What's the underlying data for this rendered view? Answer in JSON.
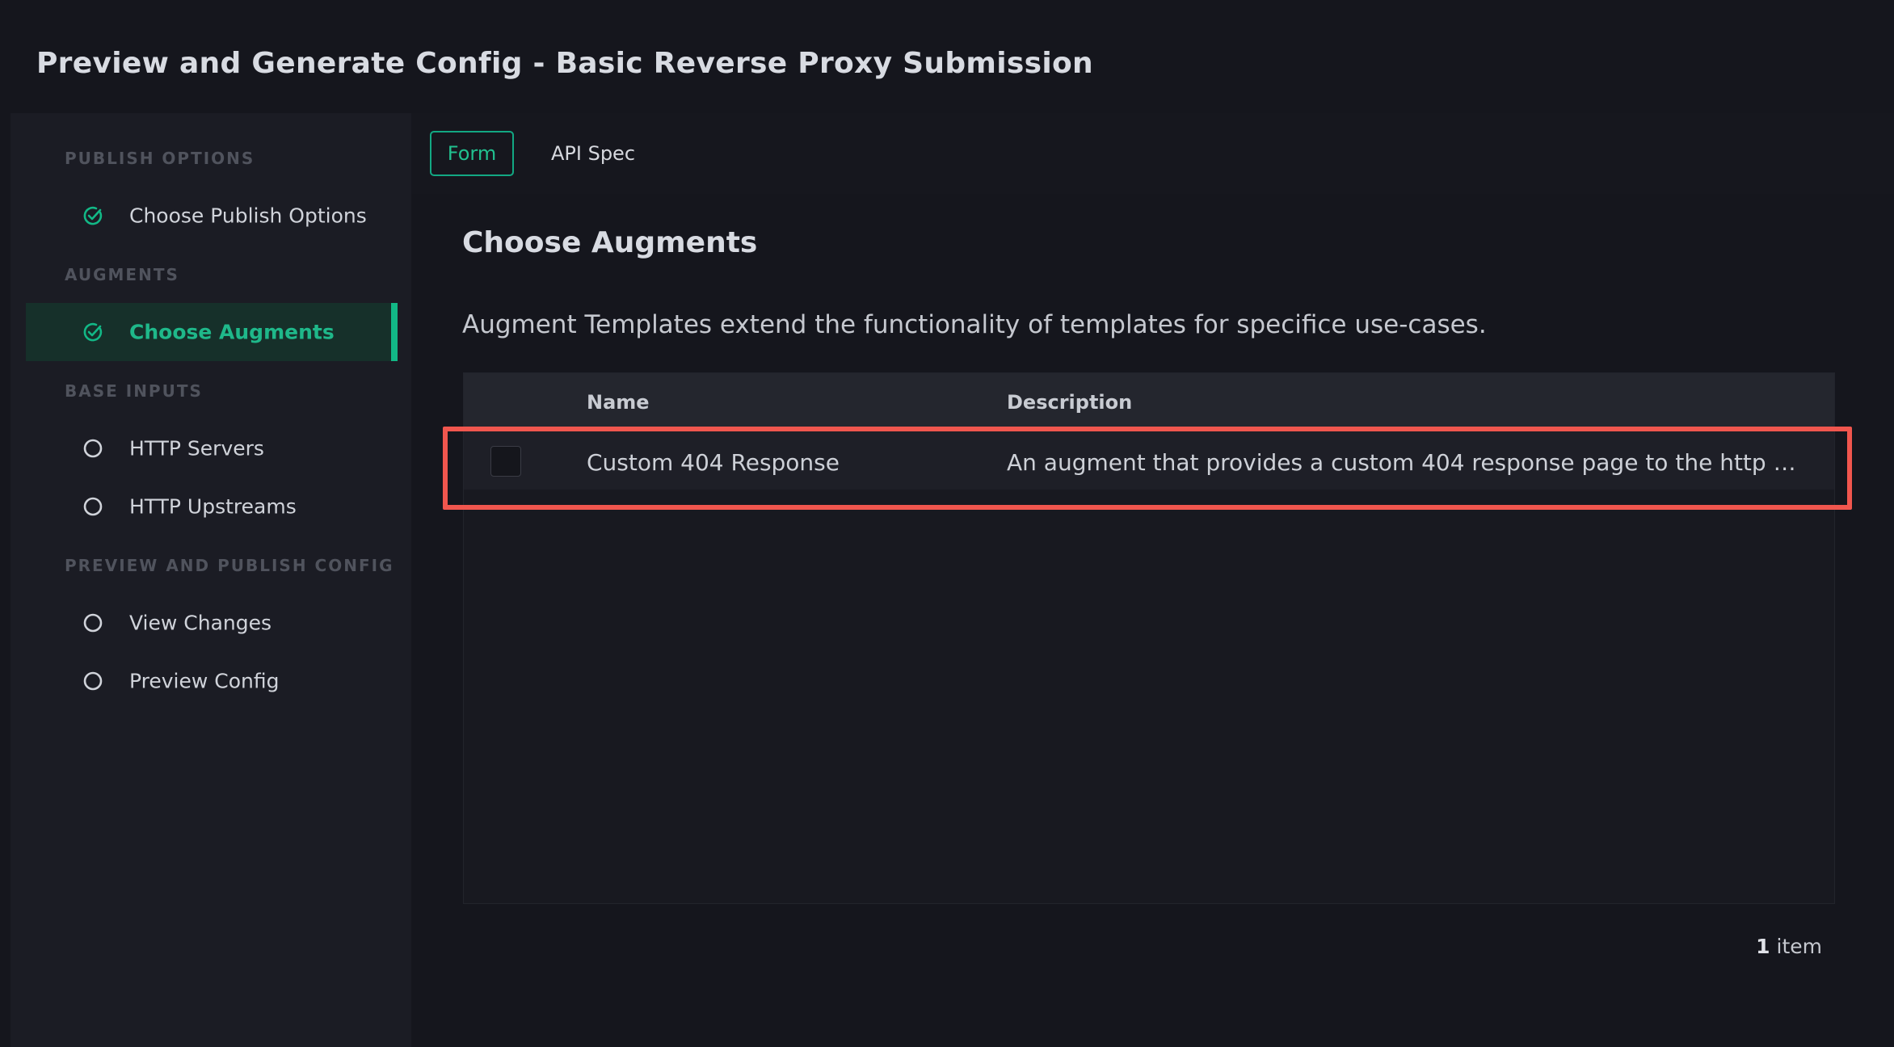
{
  "page": {
    "title": "Preview and Generate Config - Basic Reverse Proxy Submission"
  },
  "sidebar": {
    "sections": [
      {
        "label": "PUBLISH OPTIONS"
      },
      {
        "label": "AUGMENTS"
      },
      {
        "label": "BASE INPUTS"
      },
      {
        "label": "PREVIEW AND PUBLISH CONFIG"
      }
    ],
    "items": [
      {
        "label": "Choose Publish Options",
        "status": "complete",
        "icon": "check-circle-icon"
      },
      {
        "label": "Choose Augments",
        "status": "complete",
        "active": true,
        "icon": "check-circle-icon"
      },
      {
        "label": "HTTP Servers",
        "status": "pending",
        "icon": "empty-circle-icon"
      },
      {
        "label": "HTTP Upstreams",
        "status": "pending",
        "icon": "empty-circle-icon"
      },
      {
        "label": "View Changes",
        "status": "pending",
        "icon": "empty-circle-icon"
      },
      {
        "label": "Preview Config",
        "status": "pending",
        "icon": "empty-circle-icon"
      }
    ]
  },
  "tabs": [
    {
      "label": "Form",
      "selected": true
    },
    {
      "label": "API Spec",
      "selected": false
    }
  ],
  "main": {
    "heading": "Choose Augments",
    "description": "Augment Templates extend the functionality of templates for specifice use-cases."
  },
  "table": {
    "columns": [
      "Name",
      "Description"
    ],
    "rows": [
      {
        "checked": false,
        "name": "Custom 404 Response",
        "description": "An augment that provides a custom 404 response page to the http s..."
      }
    ],
    "count_number": "1",
    "count_label": " item"
  },
  "colors": {
    "accent": "#12b886",
    "highlight": "#f0564e",
    "background": "#15161d"
  }
}
